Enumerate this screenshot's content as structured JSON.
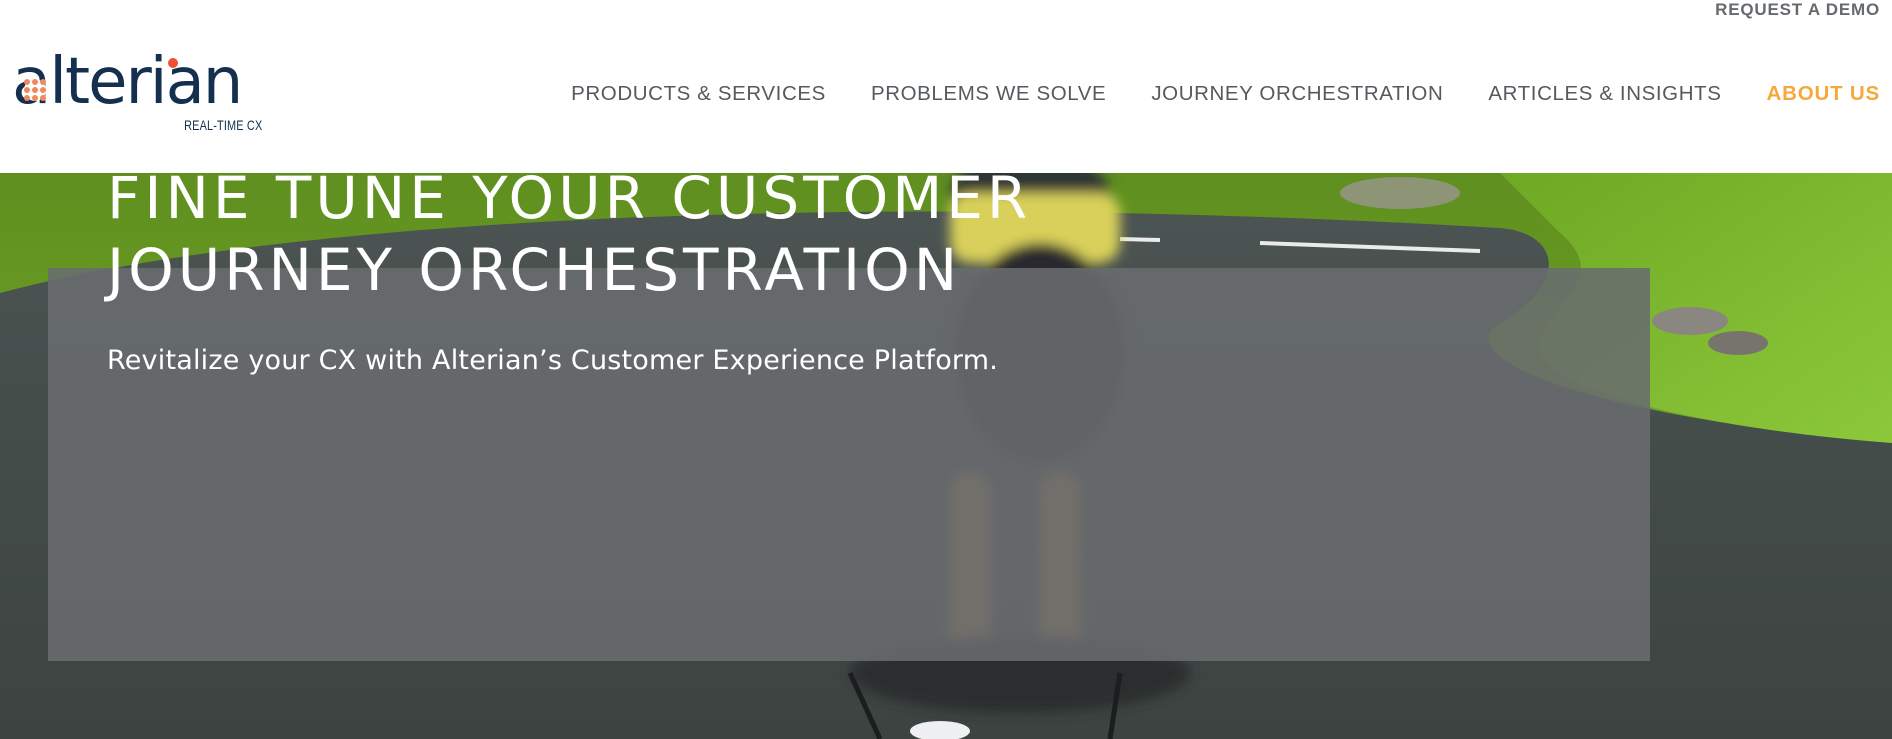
{
  "header": {
    "request_demo_label": "REQUEST A DEMO",
    "logo": {
      "wordmark": "alterian",
      "tagline": "REAL-TIME CX",
      "brand_color": "#14304e",
      "accent_color": "#f04e36"
    },
    "nav": {
      "items": [
        {
          "label": "PRODUCTS & SERVICES",
          "active": false
        },
        {
          "label": "PROBLEMS WE SOLVE",
          "active": false
        },
        {
          "label": "JOURNEY ORCHESTRATION",
          "active": false
        },
        {
          "label": "ARTICLES & INSIGHTS",
          "active": false
        },
        {
          "label": "ABOUT US",
          "active": true
        }
      ],
      "text_color": "#555a5f",
      "active_color": "#f6a93b"
    }
  },
  "hero": {
    "background_image": "cyclist riding on a winding road between green grassy hills",
    "title_lines": [
      "FINE TUNE YOUR CUSTOMER",
      "JOURNEY ORCHESTRATION"
    ],
    "subtitle": "Revitalize your CX with Alterian’s Customer Experience Platform."
  }
}
